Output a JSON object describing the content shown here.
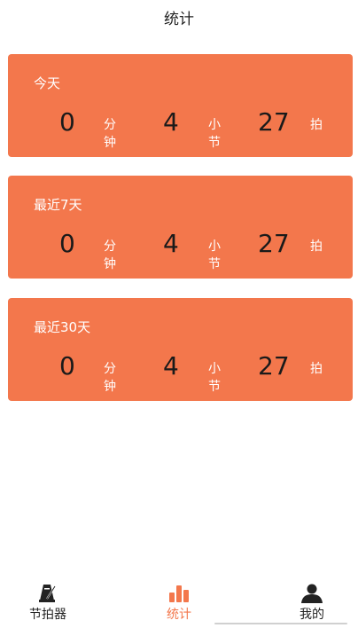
{
  "header": {
    "title": "统计"
  },
  "cards": [
    {
      "label": "今天",
      "minutes": "0",
      "minutes_unit_1": "分",
      "minutes_unit_2": "钟",
      "bars": "4",
      "bars_unit_1": "小",
      "bars_unit_2": "节",
      "beats": "27",
      "beats_unit": "拍"
    },
    {
      "label": "最近7天",
      "minutes": "0",
      "minutes_unit_1": "分",
      "minutes_unit_2": "钟",
      "bars": "4",
      "bars_unit_1": "小",
      "bars_unit_2": "节",
      "beats": "27",
      "beats_unit": "拍"
    },
    {
      "label": "最近30天",
      "minutes": "0",
      "minutes_unit_1": "分",
      "minutes_unit_2": "钟",
      "bars": "4",
      "bars_unit_1": "小",
      "bars_unit_2": "节",
      "beats": "27",
      "beats_unit": "拍"
    }
  ],
  "tabbar": {
    "items": [
      {
        "label": "节拍器",
        "icon": "metronome-icon"
      },
      {
        "label": "统计",
        "icon": "bar-chart-icon",
        "active": true
      },
      {
        "label": "我的",
        "icon": "person-icon"
      }
    ]
  },
  "colors": {
    "accent": "#f3774c",
    "card_bg": "#f3774c"
  }
}
